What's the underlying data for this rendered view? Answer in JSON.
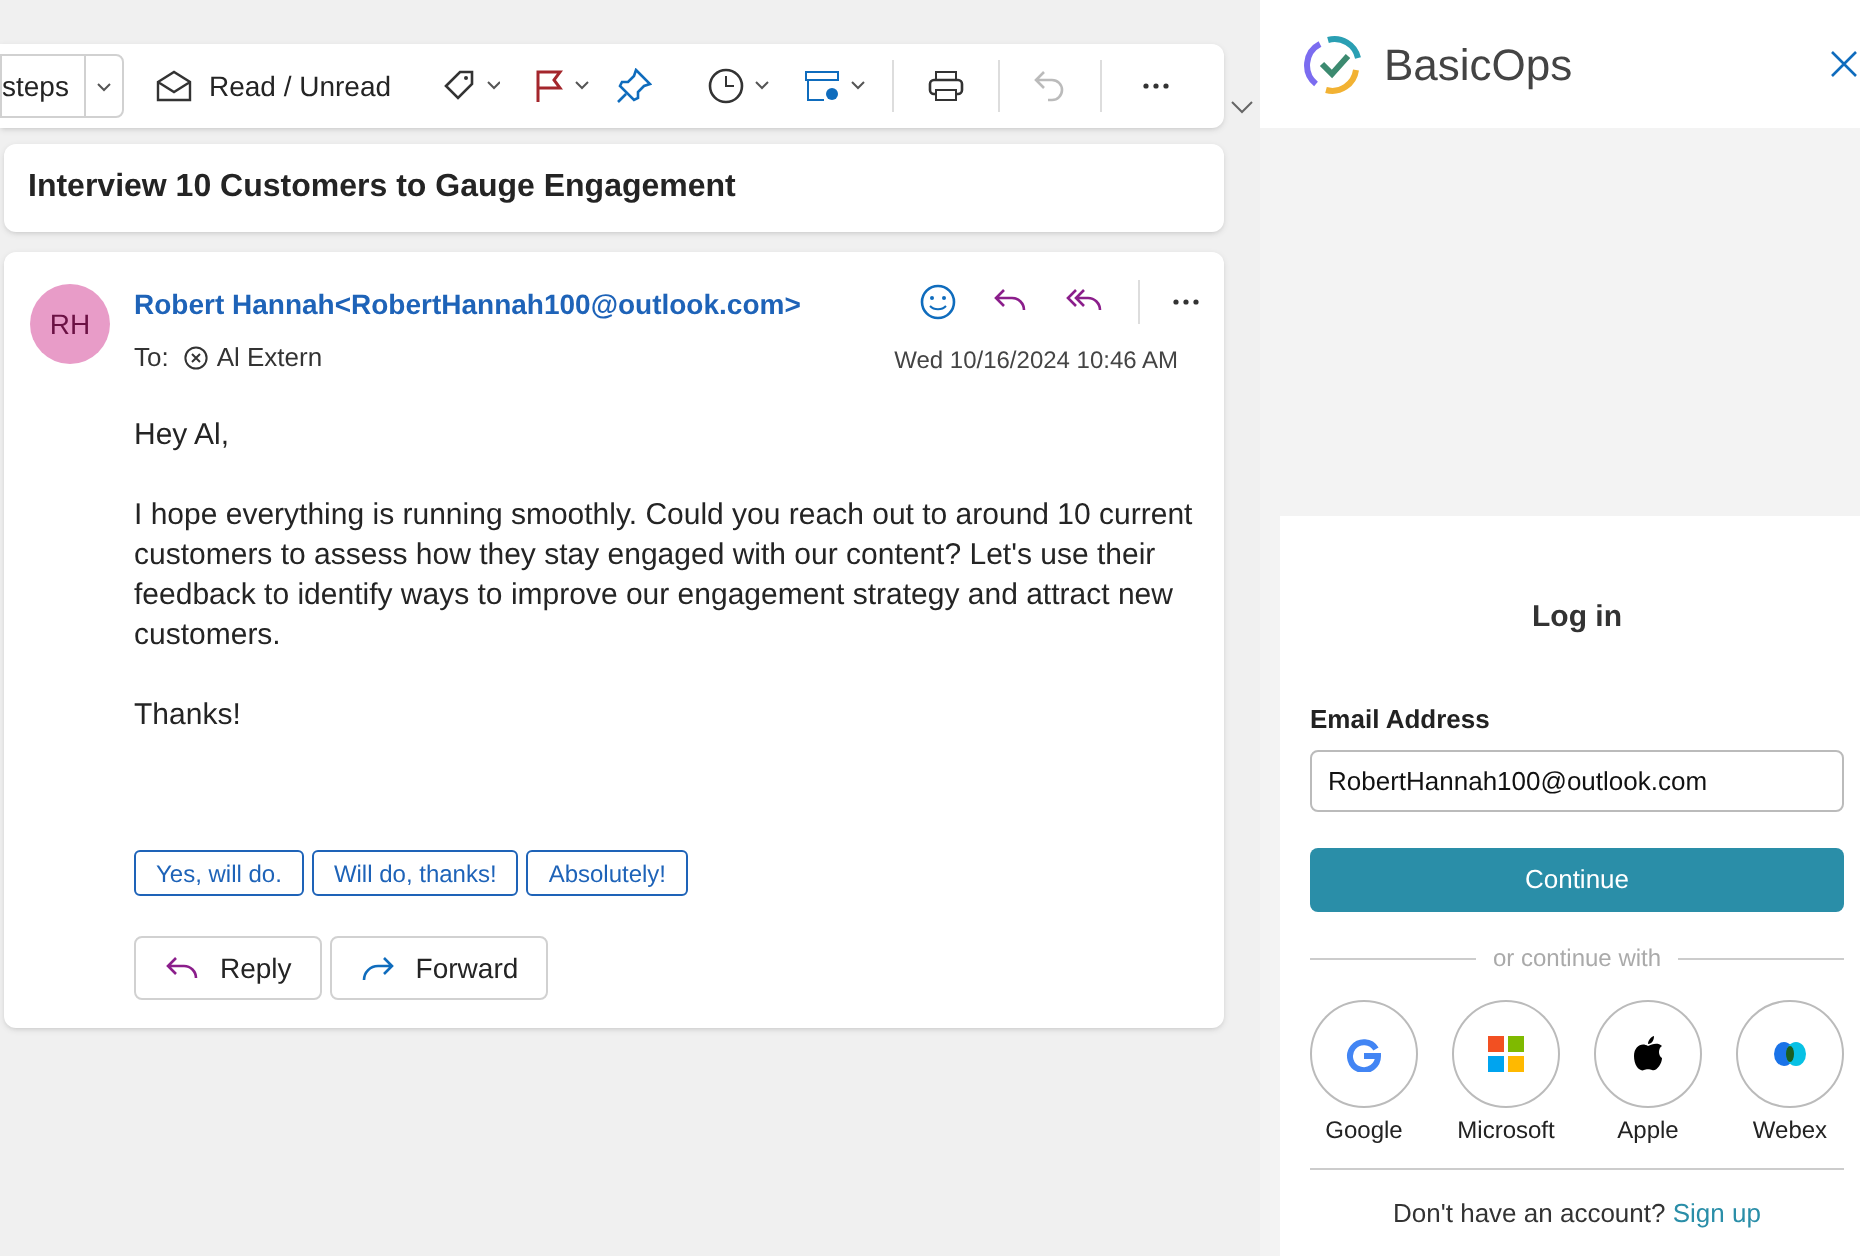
{
  "toolbar": {
    "partial_button": "steps",
    "read_unread": "Read / Unread"
  },
  "subject": "Interview 10 Customers to Gauge Engagement",
  "message": {
    "initials": "RH",
    "sender": "Robert Hannah<RobertHannah100@outlook.com>",
    "to_label": "To:",
    "recipient": "Al Extern",
    "date": "Wed 10/16/2024 10:46 AM",
    "body": [
      "Hey Al,",
      "I hope everything is running smoothly. Could you reach out to around 10 current customers to assess how they stay engaged with our content? Let's use their feedback to identify ways to improve our engagement strategy and attract new customers.",
      "Thanks!"
    ],
    "quick_replies": [
      "Yes, will do.",
      "Will do, thanks!",
      "Absolutely!"
    ],
    "actions": [
      {
        "kind": "reply",
        "label": "Reply"
      },
      {
        "kind": "forward",
        "label": "Forward"
      }
    ]
  },
  "addin": {
    "title": "BasicOps",
    "login_title": "Log in",
    "email_label": "Email Address",
    "email_value": "RobertHannah100@outlook.com",
    "continue": "Continue",
    "divider": "or continue with",
    "providers": [
      {
        "kind": "google",
        "label": "Google"
      },
      {
        "kind": "microsoft",
        "label": "Microsoft"
      },
      {
        "kind": "apple",
        "label": "Apple"
      },
      {
        "kind": "webex",
        "label": "Webex"
      }
    ],
    "signup_prompt": "Don't have an account?",
    "signup_link": "Sign up"
  }
}
